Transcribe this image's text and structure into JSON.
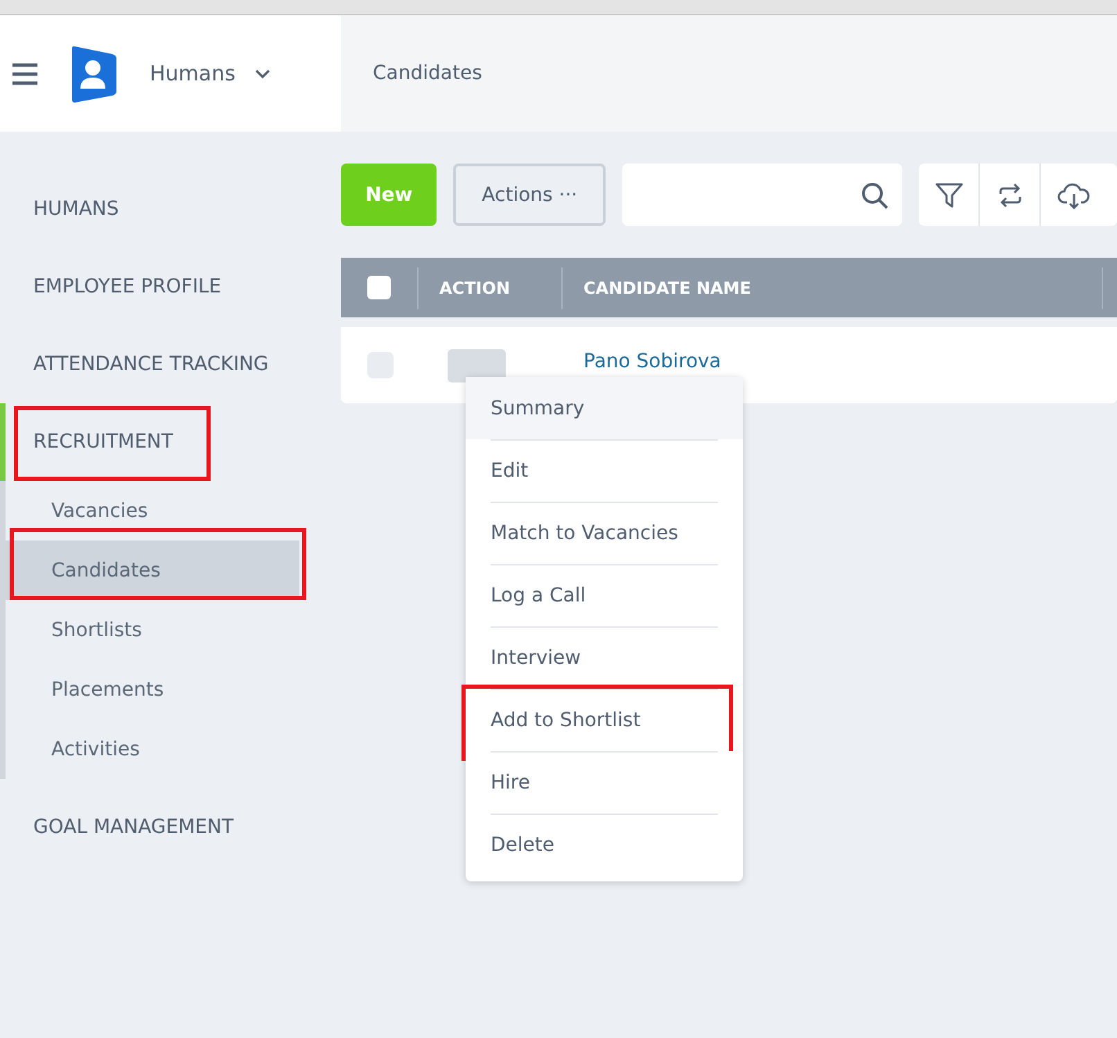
{
  "header": {
    "app_name": "Humans",
    "page_title": "Candidates"
  },
  "sidebar": {
    "items": [
      {
        "label": "HUMANS",
        "selected": false,
        "annotated": false
      },
      {
        "label": "EMPLOYEE PROFILE",
        "selected": false,
        "annotated": false
      },
      {
        "label": "ATTENDANCE TRACKING",
        "selected": false,
        "annotated": false
      },
      {
        "label": "RECRUITMENT",
        "selected": true,
        "annotated": true,
        "children": [
          {
            "label": "Vacancies",
            "selected": false,
            "annotated": false
          },
          {
            "label": "Candidates",
            "selected": true,
            "annotated": true
          },
          {
            "label": "Shortlists",
            "selected": false,
            "annotated": false
          },
          {
            "label": "Placements",
            "selected": false,
            "annotated": false
          },
          {
            "label": "Activities",
            "selected": false,
            "annotated": false
          }
        ]
      },
      {
        "label": "GOAL MANAGEMENT",
        "selected": false,
        "annotated": false
      }
    ]
  },
  "toolbar": {
    "new_button": "New",
    "actions_button": "Actions ···"
  },
  "table": {
    "columns": [
      "ACTION",
      "CANDIDATE NAME"
    ],
    "header_checked": false,
    "rows": [
      {
        "checked": false,
        "candidate_name": "Pano Sobirova"
      }
    ]
  },
  "action_menu": {
    "items": [
      {
        "label": "Summary",
        "hovered": true,
        "annotated": false
      },
      {
        "label": "Edit",
        "hovered": false,
        "annotated": false
      },
      {
        "label": "Match to Vacancies",
        "hovered": false,
        "annotated": false
      },
      {
        "label": "Log a Call",
        "hovered": false,
        "annotated": false
      },
      {
        "label": "Interview",
        "hovered": false,
        "annotated": false
      },
      {
        "label": "Add to Shortlist",
        "hovered": false,
        "annotated": true
      },
      {
        "label": "Hire",
        "hovered": false,
        "annotated": false
      },
      {
        "label": "Delete",
        "hovered": false,
        "annotated": false
      }
    ]
  }
}
